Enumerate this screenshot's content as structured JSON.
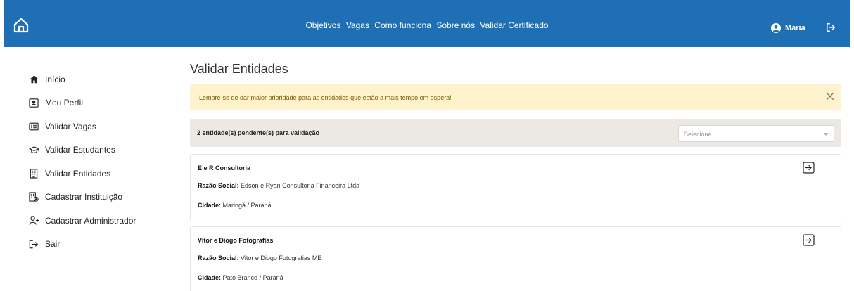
{
  "nav": {
    "links": [
      "Objetivos",
      "Vagas",
      "Como funciona",
      "Sobre nós",
      "Validar Certificado"
    ]
  },
  "user": {
    "name": "Maria"
  },
  "sidebar": {
    "items": [
      {
        "label": "Início",
        "icon": "home-icon"
      },
      {
        "label": "Meu Perfil",
        "icon": "id-card-icon"
      },
      {
        "label": "Validar Vagas",
        "icon": "list-card-icon"
      },
      {
        "label": "Validar Estudantes",
        "icon": "graduation-cap-icon"
      },
      {
        "label": "Validar Entidades",
        "icon": "building-icon"
      },
      {
        "label": "Cadastrar Instituição",
        "icon": "building-add-icon"
      },
      {
        "label": "Cadastrar Administrador",
        "icon": "user-add-icon"
      },
      {
        "label": "Sair",
        "icon": "logout-icon"
      }
    ]
  },
  "page": {
    "title": "Validar Entidades",
    "alert": "Lembre-se de dar maior prioridade para as entidades que estão a mais tempo em espera!",
    "pending_text": "2 entidade(s) pendente(s) para validação",
    "select_placeholder": "Selecione"
  },
  "entities": [
    {
      "name": "E e R Consultoria",
      "razao_label": "Razão Social:",
      "razao": "Edson e Ryan Consultoria Financeira Ltda",
      "cidade_label": "Cidade:",
      "cidade": "Maringá / Paraná"
    },
    {
      "name": "Vitor e Diogo Fotografias",
      "razao_label": "Razão Social:",
      "razao": "Vitor e Diogo Fotografias ME",
      "cidade_label": "Cidade:",
      "cidade": "Pato Branco / Paraná"
    }
  ],
  "colors": {
    "header": "#1f6fb5",
    "alert_bg": "#fff3cd",
    "pending_bg": "#ece8e4"
  }
}
